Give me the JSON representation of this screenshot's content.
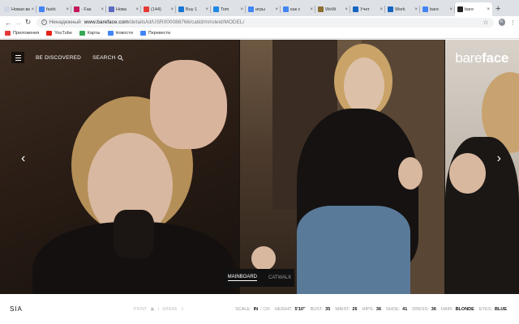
{
  "browser": {
    "tabs": [
      {
        "label": "Новая вкл",
        "color": "#cfd6e4"
      },
      {
        "label": "fashi",
        "color": "#4285f4"
      },
      {
        "label": "- Fas",
        "color": "#c2185b"
      },
      {
        "label": "Нова",
        "color": "#5c6bc0"
      },
      {
        "label": "(144)",
        "color": "#e53935"
      },
      {
        "label": "Buy 1",
        "color": "#1976d2"
      },
      {
        "label": "Tom",
        "color": "#1e88e5"
      },
      {
        "label": "игры",
        "color": "#4285f4"
      },
      {
        "label": "как с",
        "color": "#4285f4"
      },
      {
        "label": "WoW",
        "color": "#8d6e2f"
      },
      {
        "label": "Учет",
        "color": "#1565c0"
      },
      {
        "label": "Work",
        "color": "#1565c0"
      },
      {
        "label": "bare",
        "color": "#4285f4"
      },
      {
        "label": "bare",
        "color": "#222222",
        "active": true
      }
    ],
    "new_tab": "+",
    "security_label": "Ненадежный",
    "url_host": "www.bareface.com",
    "url_path": "/details/id/USR000088766/catid/m/roleid/MODEL/",
    "profile_initial": "K",
    "bookmarks": [
      {
        "label": "Приложения",
        "color": "#e53935"
      },
      {
        "label": "YouTube",
        "color": "#e62117"
      },
      {
        "label": "Карты",
        "color": "#34a853"
      },
      {
        "label": "Новости",
        "color": "#4285f4"
      },
      {
        "label": "Перевести",
        "color": "#4285f4"
      }
    ]
  },
  "site": {
    "nav_discover": "BE DISCOVERED",
    "nav_search": "SEARCH",
    "logo_light": "bare",
    "logo_bold": "face",
    "prev_arrow": "‹",
    "next_arrow": "›",
    "board_tabs": {
      "mainboard": "MAINBOARD",
      "catwalk": "CATWALK"
    }
  },
  "model": {
    "name": "SIA",
    "print_label": "PRINT",
    "share_label": "SHARE",
    "scale_label": "SCALE:",
    "scale_value": "IN",
    "scale_alt": "/ CM",
    "measurements": [
      {
        "label": "HEIGHT:",
        "value": "5'10\""
      },
      {
        "label": "BUST:",
        "value": "35"
      },
      {
        "label": "WAIST:",
        "value": "26"
      },
      {
        "label": "HIPS:",
        "value": "36"
      },
      {
        "label": "SHOE:",
        "value": "41"
      },
      {
        "label": "DRESS:",
        "value": "36"
      },
      {
        "label": "HAIR:",
        "value": "BLONDE"
      },
      {
        "label": "EYES:",
        "value": "BLUE"
      }
    ]
  }
}
